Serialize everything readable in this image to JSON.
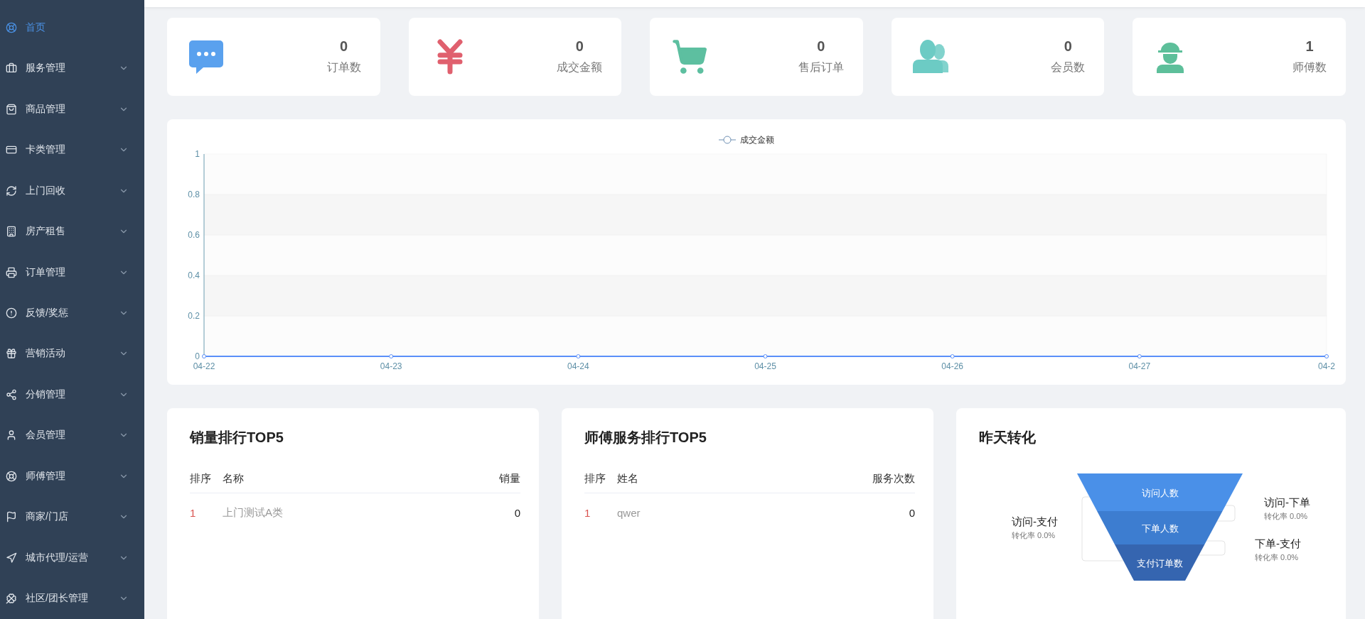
{
  "sidebar": {
    "items": [
      {
        "label": "首页",
        "selected": true,
        "expandable": false
      },
      {
        "label": "服务管理",
        "selected": false,
        "expandable": true
      },
      {
        "label": "商品管理",
        "selected": false,
        "expandable": true
      },
      {
        "label": "卡类管理",
        "selected": false,
        "expandable": true
      },
      {
        "label": "上门回收",
        "selected": false,
        "expandable": true
      },
      {
        "label": "房产租售",
        "selected": false,
        "expandable": true
      },
      {
        "label": "订单管理",
        "selected": false,
        "expandable": true
      },
      {
        "label": "反馈/奖惩",
        "selected": false,
        "expandable": true
      },
      {
        "label": "营销活动",
        "selected": false,
        "expandable": true
      },
      {
        "label": "分销管理",
        "selected": false,
        "expandable": true
      },
      {
        "label": "会员管理",
        "selected": false,
        "expandable": true
      },
      {
        "label": "师傅管理",
        "selected": false,
        "expandable": true
      },
      {
        "label": "商家/门店",
        "selected": false,
        "expandable": true
      },
      {
        "label": "城市代理/运营",
        "selected": false,
        "expandable": true
      },
      {
        "label": "社区/团长管理",
        "selected": false,
        "expandable": true
      }
    ]
  },
  "stats": [
    {
      "value": "0",
      "label": "订单数",
      "color": "#5aa1ee"
    },
    {
      "value": "0",
      "label": "成交金额",
      "color": "#e0606e"
    },
    {
      "value": "0",
      "label": "售后订单",
      "color": "#5dbfa0"
    },
    {
      "value": "0",
      "label": "会员数",
      "color": "#6ccbc4"
    },
    {
      "value": "1",
      "label": "师傅数",
      "color": "#5dbf9a"
    }
  ],
  "trend": {
    "chart_data": {
      "type": "line",
      "categories": [
        "04-22",
        "04-23",
        "04-24",
        "04-25",
        "04-26",
        "04-27",
        "04-2"
      ],
      "series": [
        {
          "name": "成交金额",
          "color": "#5b8ff9",
          "marker": "circle",
          "values": [
            0,
            0,
            0,
            0,
            0,
            0,
            0
          ]
        }
      ],
      "ylim": [
        0,
        1
      ],
      "yticks": [
        0,
        0.2,
        0.4,
        0.6,
        0.8,
        1
      ]
    }
  },
  "sales_top5": {
    "title": "销量排行TOP5",
    "columns": [
      "排序",
      "名称",
      "销量"
    ],
    "rows": [
      [
        "1",
        "上门测试A类",
        "0"
      ]
    ]
  },
  "master_top5": {
    "title": "师傅服务排行TOP5",
    "columns": [
      "排序",
      "姓名",
      "服务次数"
    ],
    "rows": [
      [
        "1",
        "qwer",
        "0"
      ]
    ]
  },
  "conversion": {
    "title": "昨天转化",
    "stages": [
      "访问人数",
      "下单人数",
      "支付订单数"
    ],
    "rates": [
      {
        "title": "访问-支付",
        "rate": "转化率 0.0%"
      },
      {
        "title": "访问-下单",
        "rate": "转化率 0.0%"
      },
      {
        "title": "下单-支付",
        "rate": "转化率 0.0%"
      }
    ]
  }
}
